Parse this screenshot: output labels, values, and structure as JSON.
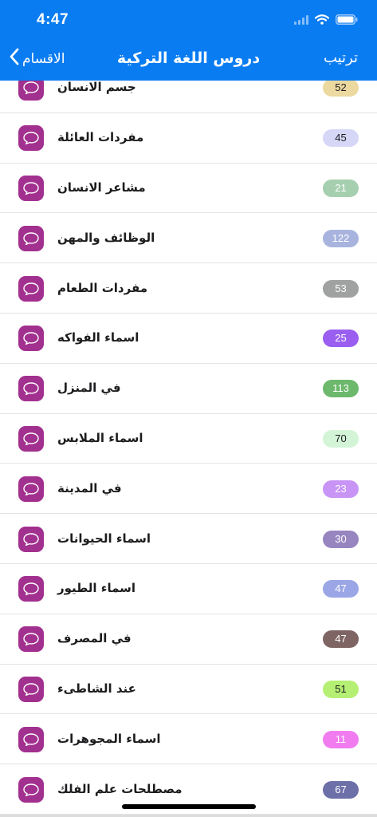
{
  "status_bar": {
    "time": "4:47"
  },
  "nav": {
    "title": "دروس اللغة التركية",
    "back_label": "الاقسام",
    "right_label": "ترتيب"
  },
  "icons": {
    "row_icon": "chat-bubble-icon",
    "back_icon": "chevron-left-icon"
  },
  "lessons": [
    {
      "label": "جسم الانسان",
      "count": "52",
      "badge_color": "#ecd9a0",
      "text_color": "#1c1c1e"
    },
    {
      "label": "مفردات العائلة",
      "count": "45",
      "badge_color": "#d6d7f7",
      "text_color": "#1c1c1e"
    },
    {
      "label": "مشاعر الانسان",
      "count": "21",
      "badge_color": "#a5cfae",
      "text_color": "#ffffff"
    },
    {
      "label": "الوظائف والمهن",
      "count": "122",
      "badge_color": "#a9b4de",
      "text_color": "#ffffff"
    },
    {
      "label": "مفردات الطعام",
      "count": "53",
      "badge_color": "#a0a1a1",
      "text_color": "#ffffff"
    },
    {
      "label": "اسماء الفواكه",
      "count": "25",
      "badge_color": "#9a5ff0",
      "text_color": "#ffffff"
    },
    {
      "label": "في المنزل",
      "count": "113",
      "badge_color": "#6cb86c",
      "text_color": "#ffffff"
    },
    {
      "label": "اسماء الملابس",
      "count": "70",
      "badge_color": "#d4f4d7",
      "text_color": "#1c1c1e"
    },
    {
      "label": "في المدينة",
      "count": "23",
      "badge_color": "#c894f6",
      "text_color": "#ffffff"
    },
    {
      "label": "اسماء الحيوانات",
      "count": "30",
      "badge_color": "#9785c0",
      "text_color": "#ffffff"
    },
    {
      "label": "اسماء الطيور",
      "count": "47",
      "badge_color": "#9aa6e6",
      "text_color": "#ffffff"
    },
    {
      "label": "في المصرف",
      "count": "47",
      "badge_color": "#7e6563",
      "text_color": "#ffffff"
    },
    {
      "label": "عند الشاطىء",
      "count": "51",
      "badge_color": "#b5ef73",
      "text_color": "#1c1c1e"
    },
    {
      "label": "اسماء المجوهرات",
      "count": "11",
      "badge_color": "#f07cf0",
      "text_color": "#ffffff"
    },
    {
      "label": "مصطلحات علم الفلك",
      "count": "67",
      "badge_color": "#6d6fa8",
      "text_color": "#ffffff"
    }
  ]
}
